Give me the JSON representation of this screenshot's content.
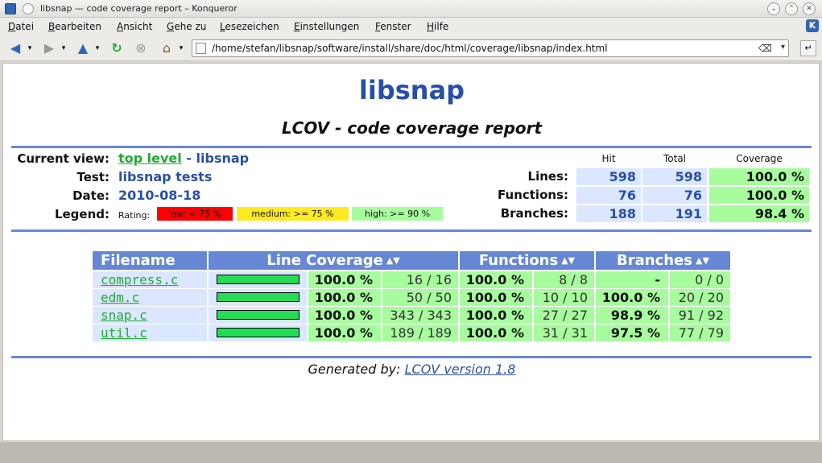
{
  "window": {
    "title": "libsnap — code coverage report – Konqueror"
  },
  "menu": [
    "Datei",
    "Bearbeiten",
    "Ansicht",
    "Gehe zu",
    "Lesezeichen",
    "Einstellungen",
    "Fenster",
    "Hilfe"
  ],
  "address": {
    "url": "/home/stefan/libsnap/software/install/share/doc/html/coverage/libsnap/index.html"
  },
  "report": {
    "title": "libsnap",
    "subtitle": "LCOV - code coverage report",
    "current_view_label": "Current view:",
    "current_view_link": "top level",
    "current_view_sep": " - libsnap",
    "test_label": "Test:",
    "test_value": "libsnap tests",
    "date_label": "Date:",
    "date_value": "2010-08-18",
    "legend_label": "Legend:",
    "legend_rating": "Rating:",
    "legend_low": "low: < 75 %",
    "legend_medium": "medium: >= 75 %",
    "legend_high": "high: >= 90 %",
    "colors": {
      "low": "#ff0000",
      "medium": "#ffea20",
      "high": "#a7fc9d",
      "header": "#6688d4",
      "cell": "#dae7fe"
    }
  },
  "summary": {
    "headers": {
      "hit": "Hit",
      "total": "Total",
      "coverage": "Coverage"
    },
    "rows": [
      {
        "label": "Lines:",
        "hit": "598",
        "total": "598",
        "coverage": "100.0 %"
      },
      {
        "label": "Functions:",
        "hit": "76",
        "total": "76",
        "coverage": "100.0 %"
      },
      {
        "label": "Branches:",
        "hit": "188",
        "total": "191",
        "coverage": "98.4 %"
      }
    ]
  },
  "files": {
    "headers": {
      "filename": "Filename",
      "line": "Line Coverage",
      "functions": "Functions",
      "branches": "Branches"
    },
    "sort_icon": "sort-updown-icon",
    "rows": [
      {
        "name": "compress.c",
        "line_fraction": 1.0,
        "line_pct": "100.0 %",
        "line_cnt": "16 / 16",
        "fn_pct": "100.0 %",
        "fn_cnt": "8 / 8",
        "br_pct": "-",
        "br_cnt": "0 / 0"
      },
      {
        "name": "edm.c",
        "line_fraction": 1.0,
        "line_pct": "100.0 %",
        "line_cnt": "50 / 50",
        "fn_pct": "100.0 %",
        "fn_cnt": "10 / 10",
        "br_pct": "100.0 %",
        "br_cnt": "20 / 20"
      },
      {
        "name": "snap.c",
        "line_fraction": 1.0,
        "line_pct": "100.0 %",
        "line_cnt": "343 / 343",
        "fn_pct": "100.0 %",
        "fn_cnt": "27 / 27",
        "br_pct": "98.9 %",
        "br_cnt": "91 / 92"
      },
      {
        "name": "util.c",
        "line_fraction": 1.0,
        "line_pct": "100.0 %",
        "line_cnt": "189 / 189",
        "fn_pct": "100.0 %",
        "fn_cnt": "31 / 31",
        "br_pct": "97.5 %",
        "br_cnt": "77 / 79"
      }
    ]
  },
  "footer": {
    "prefix": "Generated by: ",
    "link": "LCOV version 1.8"
  }
}
